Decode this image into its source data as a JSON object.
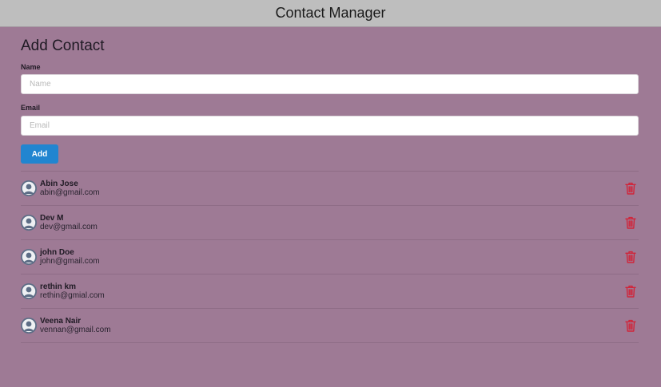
{
  "app": {
    "title": "Contact Manager"
  },
  "form": {
    "heading": "Add Contact",
    "name_label": "Name",
    "name_placeholder": "Name",
    "name_value": "",
    "email_label": "Email",
    "email_placeholder": "Email",
    "email_value": "",
    "add_label": "Add"
  },
  "contacts": [
    {
      "name": "Abin Jose",
      "email": "abin@gmail.com"
    },
    {
      "name": "Dev M",
      "email": "dev@gmail.com"
    },
    {
      "name": "john Doe",
      "email": "john@gmail.com"
    },
    {
      "name": "rethin km",
      "email": "rethin@gmial.com"
    },
    {
      "name": "Veena Nair",
      "email": "vennan@gmail.com"
    }
  ],
  "icons": {
    "avatar": "user-avatar-icon",
    "delete": "trash-icon"
  },
  "colors": {
    "page_background": "#9e7a95",
    "header_background": "#bebebe",
    "add_button": "#2185d0",
    "delete_icon": "#d0253a"
  }
}
